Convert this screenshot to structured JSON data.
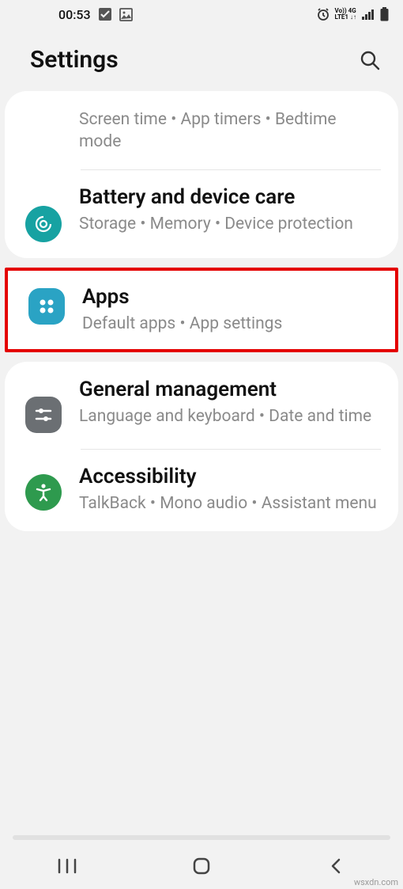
{
  "status": {
    "time": "00:53",
    "network_label": "Vo)) 4G\nLTE1 ↓↑"
  },
  "header": {
    "title": "Settings"
  },
  "card1": {
    "digital_wellbeing": {
      "sub": "Screen time  •  App timers  •  Bedtime mode"
    },
    "battery": {
      "title": "Battery and device care",
      "sub": "Storage  •  Memory  •  Device protection"
    }
  },
  "apps": {
    "title": "Apps",
    "sub": "Default apps  •  App settings"
  },
  "card2": {
    "general": {
      "title": "General management",
      "sub": "Language and keyboard  •  Date and time"
    },
    "accessibility": {
      "title": "Accessibility",
      "sub": "TalkBack  •  Mono audio  •  Assistant menu"
    }
  },
  "watermark": "wsxdn.com"
}
